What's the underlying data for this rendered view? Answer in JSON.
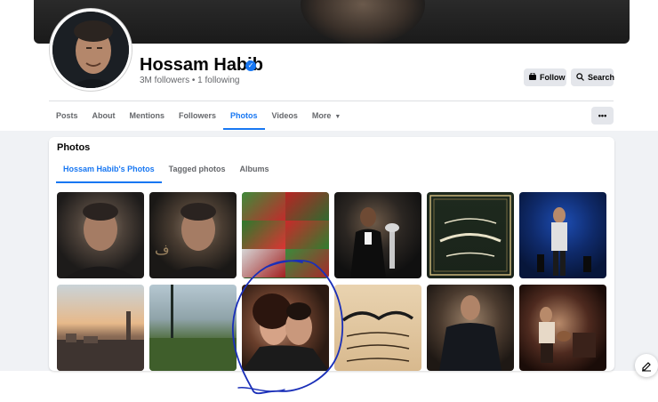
{
  "profile": {
    "name": "Hossam Habib",
    "followers_text": "3M followers • 1 following",
    "verified_icon": "verified-badge-icon"
  },
  "actions": {
    "follow_label": "Follow",
    "search_label": "Search",
    "more_label": "•••"
  },
  "tabs": [
    {
      "label": "Posts"
    },
    {
      "label": "About"
    },
    {
      "label": "Mentions"
    },
    {
      "label": "Followers"
    },
    {
      "label": "Photos"
    },
    {
      "label": "Videos"
    },
    {
      "label": "More"
    }
  ],
  "active_tab": "Photos",
  "photos": {
    "title": "Photos",
    "subtabs": [
      {
        "label": "Hossam Habib's Photos"
      },
      {
        "label": "Tagged photos"
      },
      {
        "label": "Albums"
      }
    ]
  },
  "colors": {
    "accent": "#1877f2",
    "background": "#f0f2f5",
    "button_bg": "#e4e6eb",
    "scribble": "#1a2fb8"
  }
}
